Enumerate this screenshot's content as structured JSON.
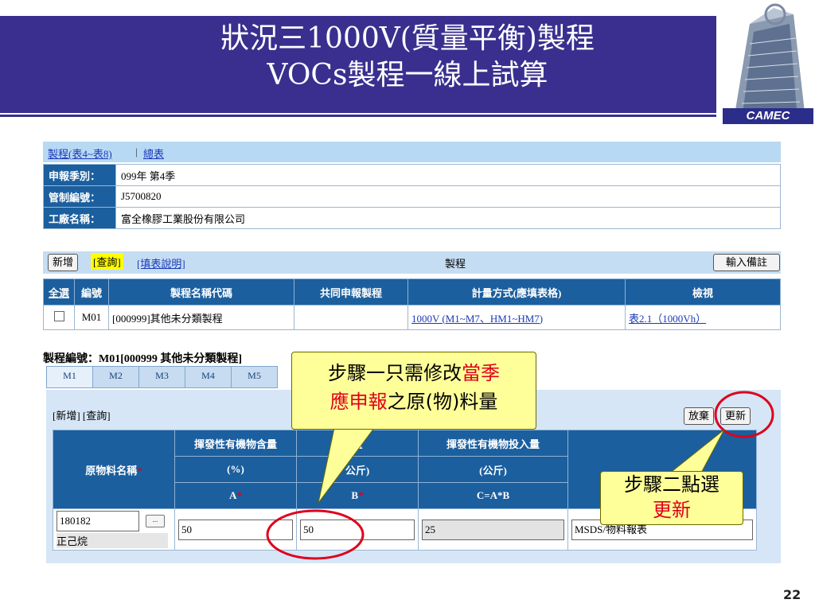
{
  "slide": {
    "title_line1": "狀況三1000V(質量平衡)製程",
    "title_line2": "VOCs製程一線上試算",
    "logo_text": "CAMEC",
    "page_number": "22"
  },
  "topbar": {
    "link1": "製程(表4~表8)",
    "separator": "|",
    "link2": "總表"
  },
  "info": [
    {
      "label": "申報季別：",
      "value": "099年 第4季"
    },
    {
      "label": "管制編號：",
      "value": "J5700820"
    },
    {
      "label": "工廠名稱：",
      "value": "富全橡膠工業股份有限公司"
    }
  ],
  "actions": {
    "add": "新增",
    "query": "[查詢]",
    "help": "[填表說明]",
    "section": "製程",
    "note": "輸入備註"
  },
  "main_table": {
    "headers": [
      "全選",
      "編號",
      "製程名稱代碼",
      "共同申報製程",
      "計量方式(應填表格)",
      "檢視"
    ],
    "row": {
      "id": "M01",
      "name": "[000999]其他未分類製程",
      "shared": "",
      "method": "1000V (M1~M7、HM1~HM7)",
      "view": "表2.1（1000Vh）"
    }
  },
  "process": {
    "label": "製程編號：M01[000999 其他未分類製程]",
    "tabs": [
      "M1",
      "M2",
      "M3",
      "M4",
      "M5"
    ],
    "sub_actions": "[新增] [查詢]",
    "discard": "放棄",
    "update": "更新"
  },
  "sub_table": {
    "h_name": "原物料名稱",
    "h_a1": "揮發性有機物含量",
    "h_a2": "(%)",
    "h_a3": "A",
    "h_b1": "量",
    "h_b2": "公斤)",
    "h_b3": "B",
    "h_c1": "揮發性有機物投入量",
    "h_c2": "(公斤)",
    "h_c3": "C=A*B",
    "h_d1": "",
    "row": {
      "code": "180182",
      "name": "正己烷",
      "a": "50",
      "b": "50",
      "c": "25",
      "d": "MSDS/物料報表"
    },
    "star": "*"
  },
  "callout1": {
    "line1_prefix": "步驟一只需修改",
    "line1_red": "當季",
    "line2_red": "應申報",
    "line2_suffix": "之原(物)料量"
  },
  "callout2": {
    "line1": "步驟二點選",
    "line2_red": "更新"
  },
  "colors": {
    "header_bg": "#3a2f8f",
    "table_header": "#1b5f9e",
    "callout_bg": "#ffff99",
    "highlight_red": "#e0001b"
  }
}
